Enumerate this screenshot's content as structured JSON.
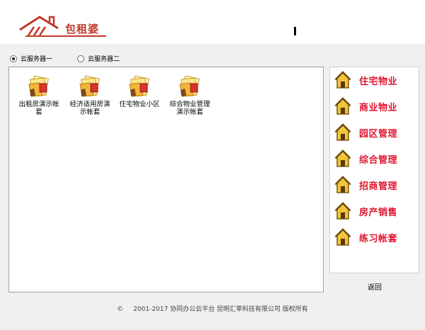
{
  "header": {
    "logo_text": "包租婆"
  },
  "servers": {
    "options": [
      "云服务器一",
      "云服务器二"
    ],
    "selected": 0
  },
  "files": [
    {
      "label_lines": [
        "出租房演示帐",
        "套"
      ]
    },
    {
      "label_lines": [
        "经济适用房演",
        "示帐套"
      ]
    },
    {
      "label_lines": [
        "住宅物业小区"
      ]
    },
    {
      "label_lines": [
        "综合物业管理",
        "演示帐套"
      ]
    }
  ],
  "menu": {
    "items": [
      "住宅物业",
      "商业物业",
      "园区管理",
      "综合管理",
      "招商管理",
      "房产销售",
      "练习帐套"
    ],
    "back_label": "返回"
  },
  "footer": {
    "copyright_symbol": "©",
    "text": "2001-2017  协同办公云平台  昆明汇莘科技有限公司  版权所有"
  },
  "colors": {
    "accent_red": "#e0152f",
    "logo_red": "#c0392b",
    "house_yellow": "#f2c43a"
  }
}
